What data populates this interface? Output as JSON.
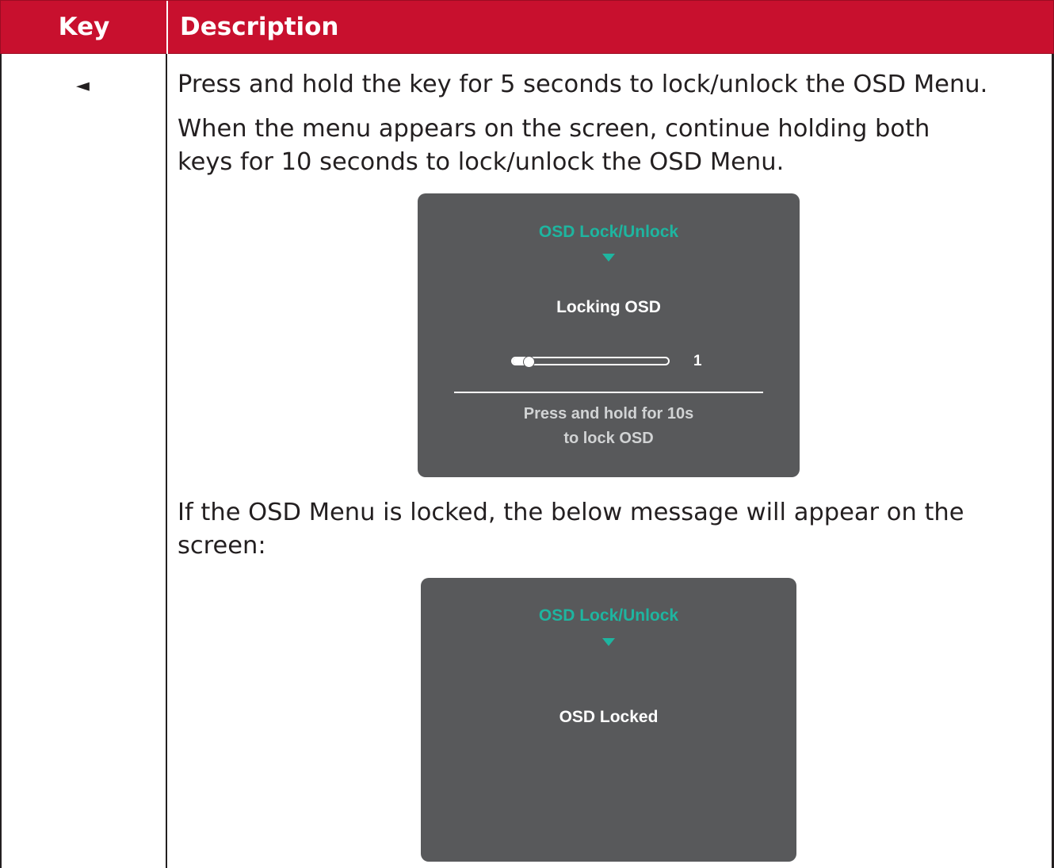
{
  "table": {
    "header": {
      "key": "Key",
      "description": "Description"
    },
    "colors": {
      "header_bg": "#c8102e",
      "header_text": "#ffffff",
      "border": "#231f20"
    },
    "row": {
      "key_icon": "left-arrow-key-icon",
      "key_glyph": "◄",
      "paragraphs": [
        "Press and hold the key for 5 seconds to lock/unlock the OSD Menu.",
        "When the menu appears on the screen, continue holding both",
        "keys for 10 seconds to lock/unlock the OSD Menu.",
        "If the OSD Menu is locked, the below message will appear on the",
        "screen:"
      ]
    }
  },
  "osd_locking": {
    "title": "OSD Lock/Unlock",
    "status": "Locking OSD",
    "progress_value": "1",
    "progress_fraction": 0.1,
    "footer_line1": "Press and hold for 10s",
    "footer_line2": "to lock OSD",
    "colors": {
      "panel": "#58595b",
      "accent": "#1eb5a0",
      "text": "#ffffff"
    }
  },
  "osd_locked": {
    "title": "OSD Lock/Unlock",
    "status": "OSD Locked"
  }
}
